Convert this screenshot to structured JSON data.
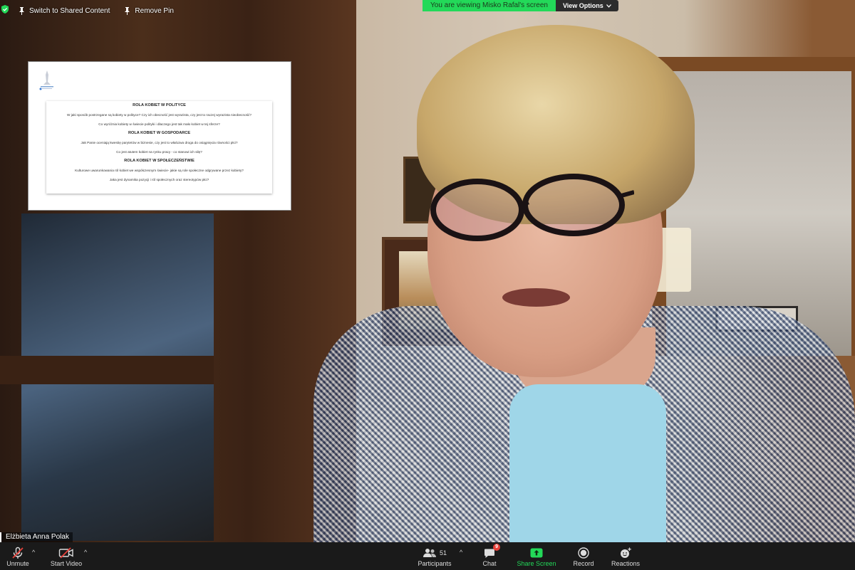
{
  "topbar": {
    "switch_label": "Switch to Shared Content",
    "remove_pin_label": "Remove Pin"
  },
  "banner": {
    "viewing_text": "You are viewing Misko Rafal's screen",
    "view_options_label": "View Options"
  },
  "shared_slide": {
    "sections": [
      {
        "title": "ROLA KOBIET W POLITYCE",
        "bullets": [
          "W jaki sposób postrzegane są kobiety w polityce? Czy ich obecność jest wyrazista, czy jest to raczej wyrazista nieobecność?",
          "Co wyróżnia kobiety w świecie polityki i dlaczego jest tak mało kobiet w tej sferze?"
        ]
      },
      {
        "title": "ROLA KOBIET W GOSPODARCE",
        "bullets": [
          "Jak Panie oceniają kwestię parytetów w biznesie, czy jest to właściwa droga do osiągnięcia równości płci?",
          "Co jest atutem kobiet na rynku pracy - co stanowi ich siłę?"
        ]
      },
      {
        "title": "ROLA KOBIET W SPOŁECZEŃSTWIE",
        "bullets": [
          "Kulturowe uwarunkowania ról kobiet we współczesnym świecie- jakie są role społeczne odgrywane przez kobiety?",
          "Jaka jest dynamika pozycji i ról społecznych oraz stereotypów płci?"
        ]
      }
    ]
  },
  "participant": {
    "name": "Elżbieta Anna Polak"
  },
  "toolbar": {
    "unmute_label": "Unmute",
    "start_video_label": "Start Video",
    "participants_label": "Participants",
    "participants_count": "51",
    "chat_label": "Chat",
    "chat_badge": "9",
    "share_label": "Share Screen",
    "record_label": "Record",
    "reactions_label": "Reactions"
  },
  "colors": {
    "banner_green": "#23d959",
    "toolbar_bg": "#1a1a1a",
    "badge_red": "#e8403a",
    "mute_red": "#e8403a"
  }
}
